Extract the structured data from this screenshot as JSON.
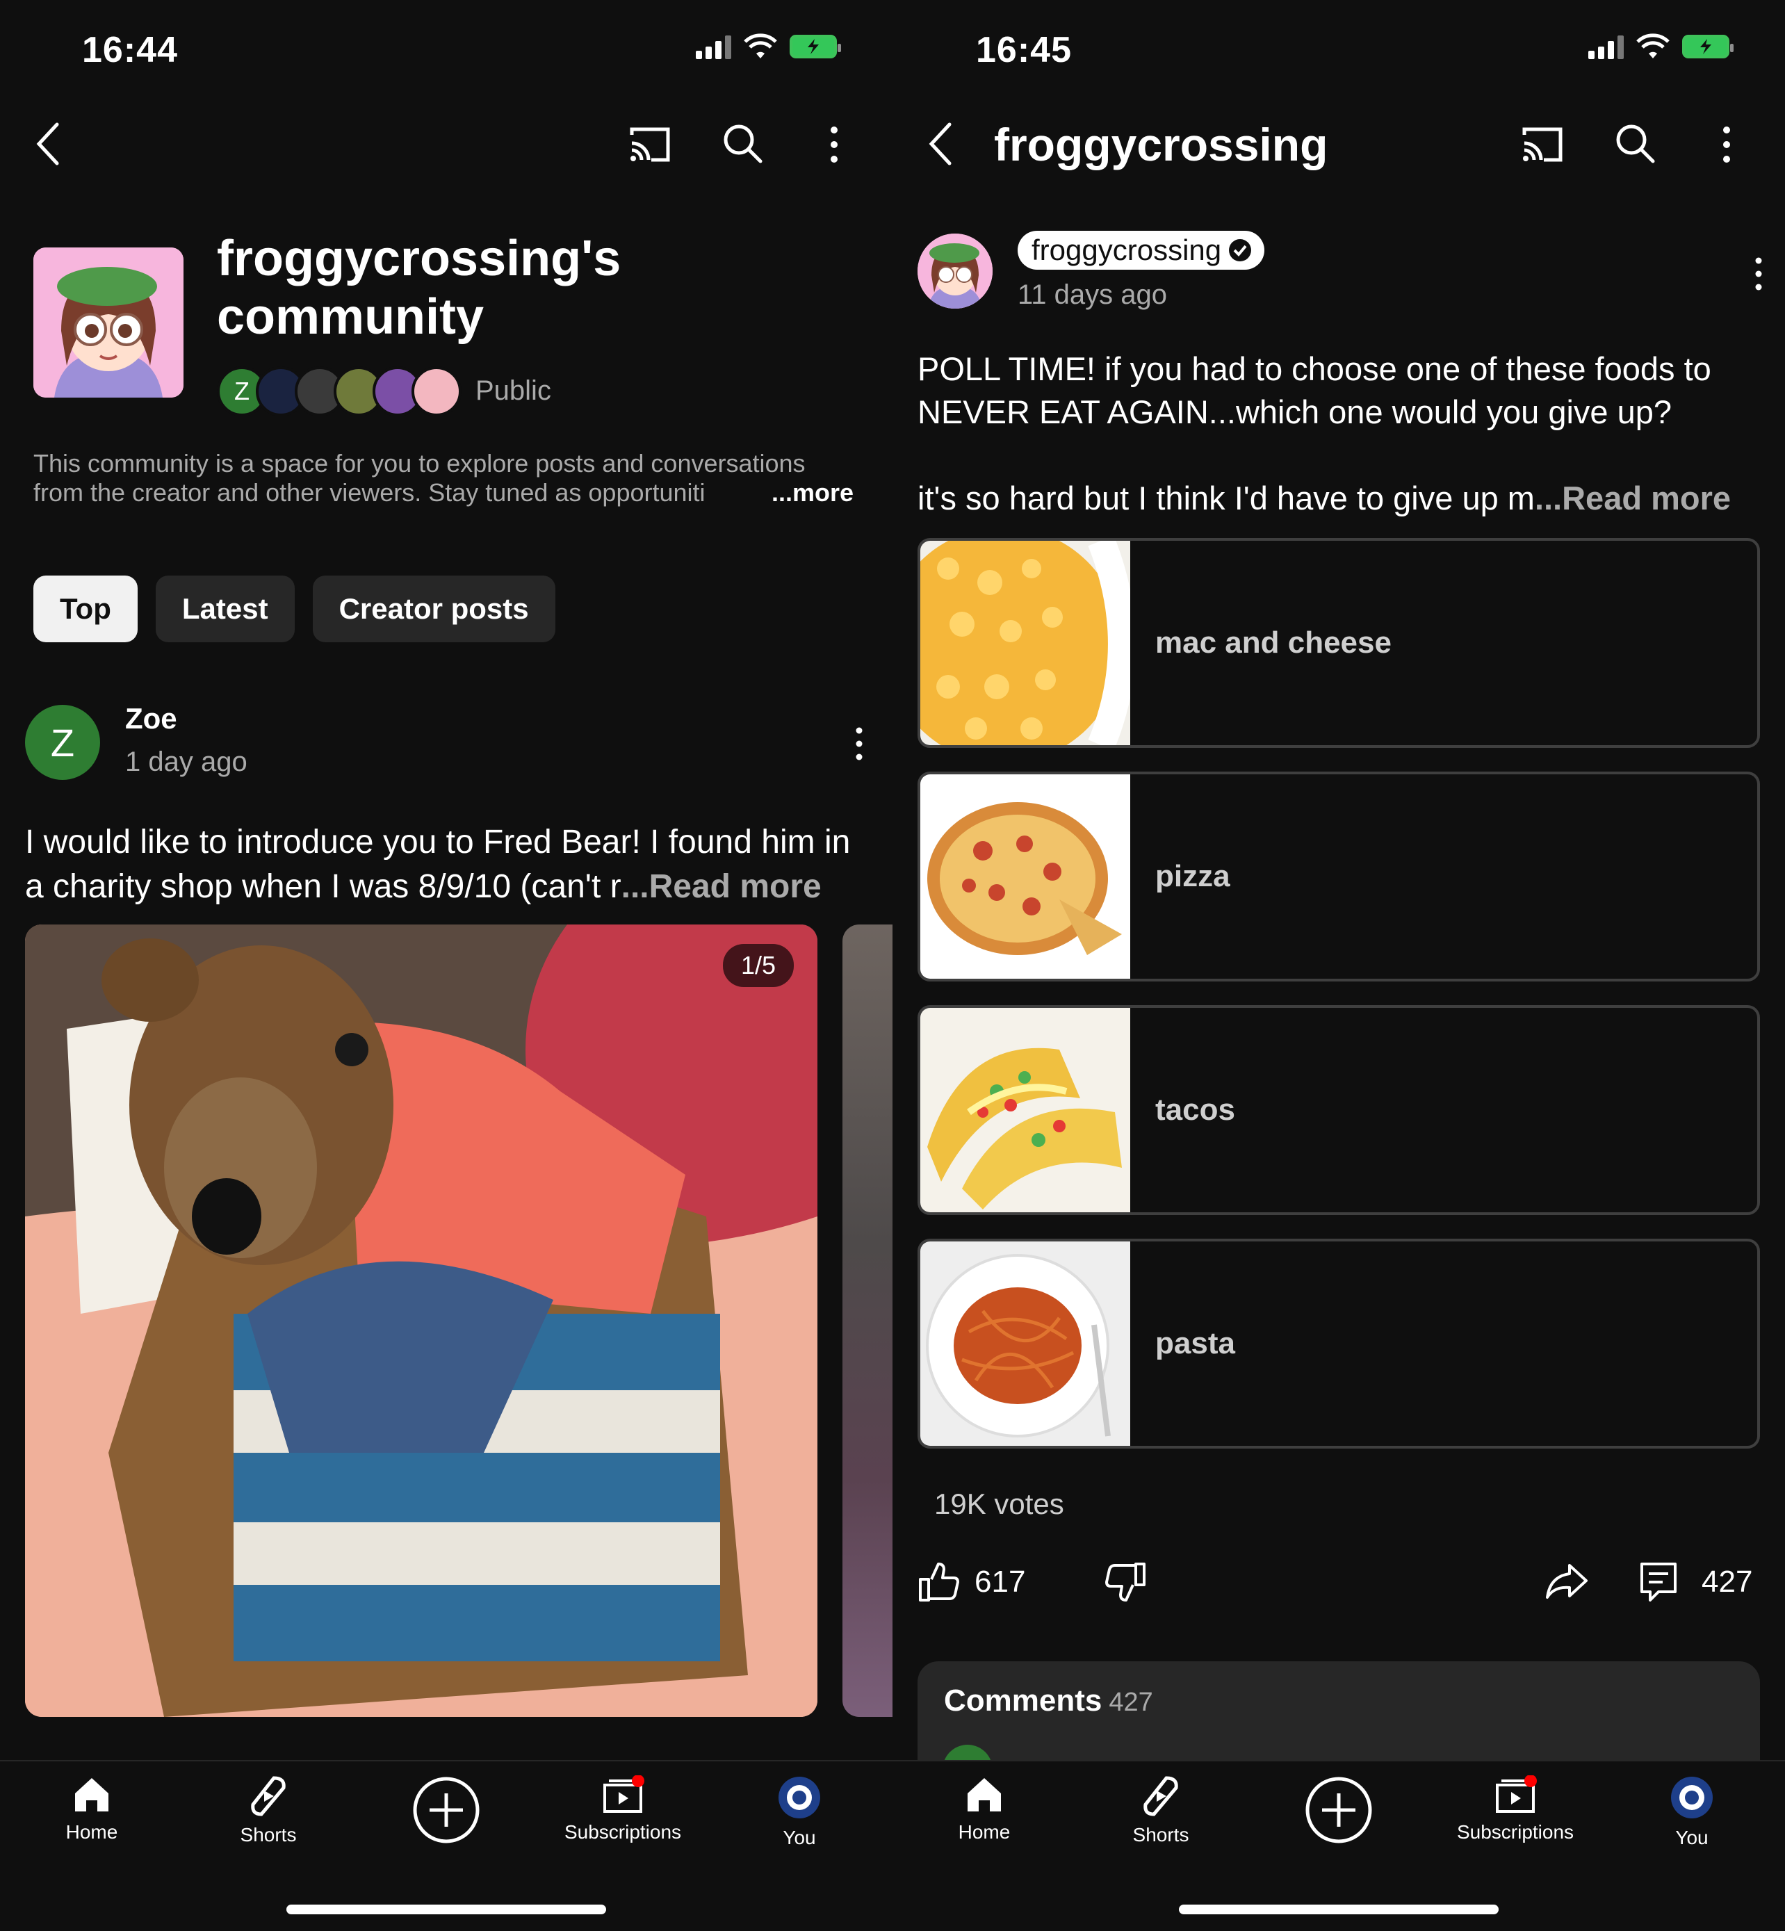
{
  "left": {
    "status": {
      "time": "16:44"
    },
    "community": {
      "title": "froggycrossing's community",
      "member_initial": "Z",
      "visibility": "Public",
      "description": "This community is a space for you to explore posts and conversations from the creator and other viewers. Stay tuned as opportuniti",
      "more": "...more"
    },
    "filters": [
      "Top",
      "Latest",
      "Creator posts"
    ],
    "post": {
      "avatar_initial": "Z",
      "author": "Zoe",
      "time": "1 day ago",
      "text": "I would like to introduce you to Fred Bear! I found him in a charity shop when I was 8/9/10 (can't r",
      "read_more": "...Read more",
      "image_counter": "1/5"
    }
  },
  "right": {
    "status": {
      "time": "16:45"
    },
    "header_title": "froggycrossing",
    "post": {
      "author": "froggycrossing",
      "time": "11 days ago",
      "text1": "POLL TIME! if you had to choose one of these foods to NEVER EAT AGAIN...which one would you give up?",
      "text2": "it's so hard but I think I'd have to give up m",
      "read_more": "...Read more",
      "poll_options": [
        "mac and cheese",
        "pizza",
        "tacos",
        "pasta"
      ],
      "votes": "19K votes",
      "likes": "617",
      "comments_count": "427"
    },
    "comments": {
      "label": "Comments",
      "count": "427"
    }
  },
  "nav": {
    "home": "Home",
    "shorts": "Shorts",
    "subscriptions": "Subscriptions",
    "you": "You"
  },
  "colors": {
    "background": "#0f0f0f",
    "chip": "#272727",
    "chip_active": "#f1f1f1",
    "battery": "#34c759",
    "notification_dot": "#ff0000",
    "avatar_green": "#2e7d32"
  }
}
